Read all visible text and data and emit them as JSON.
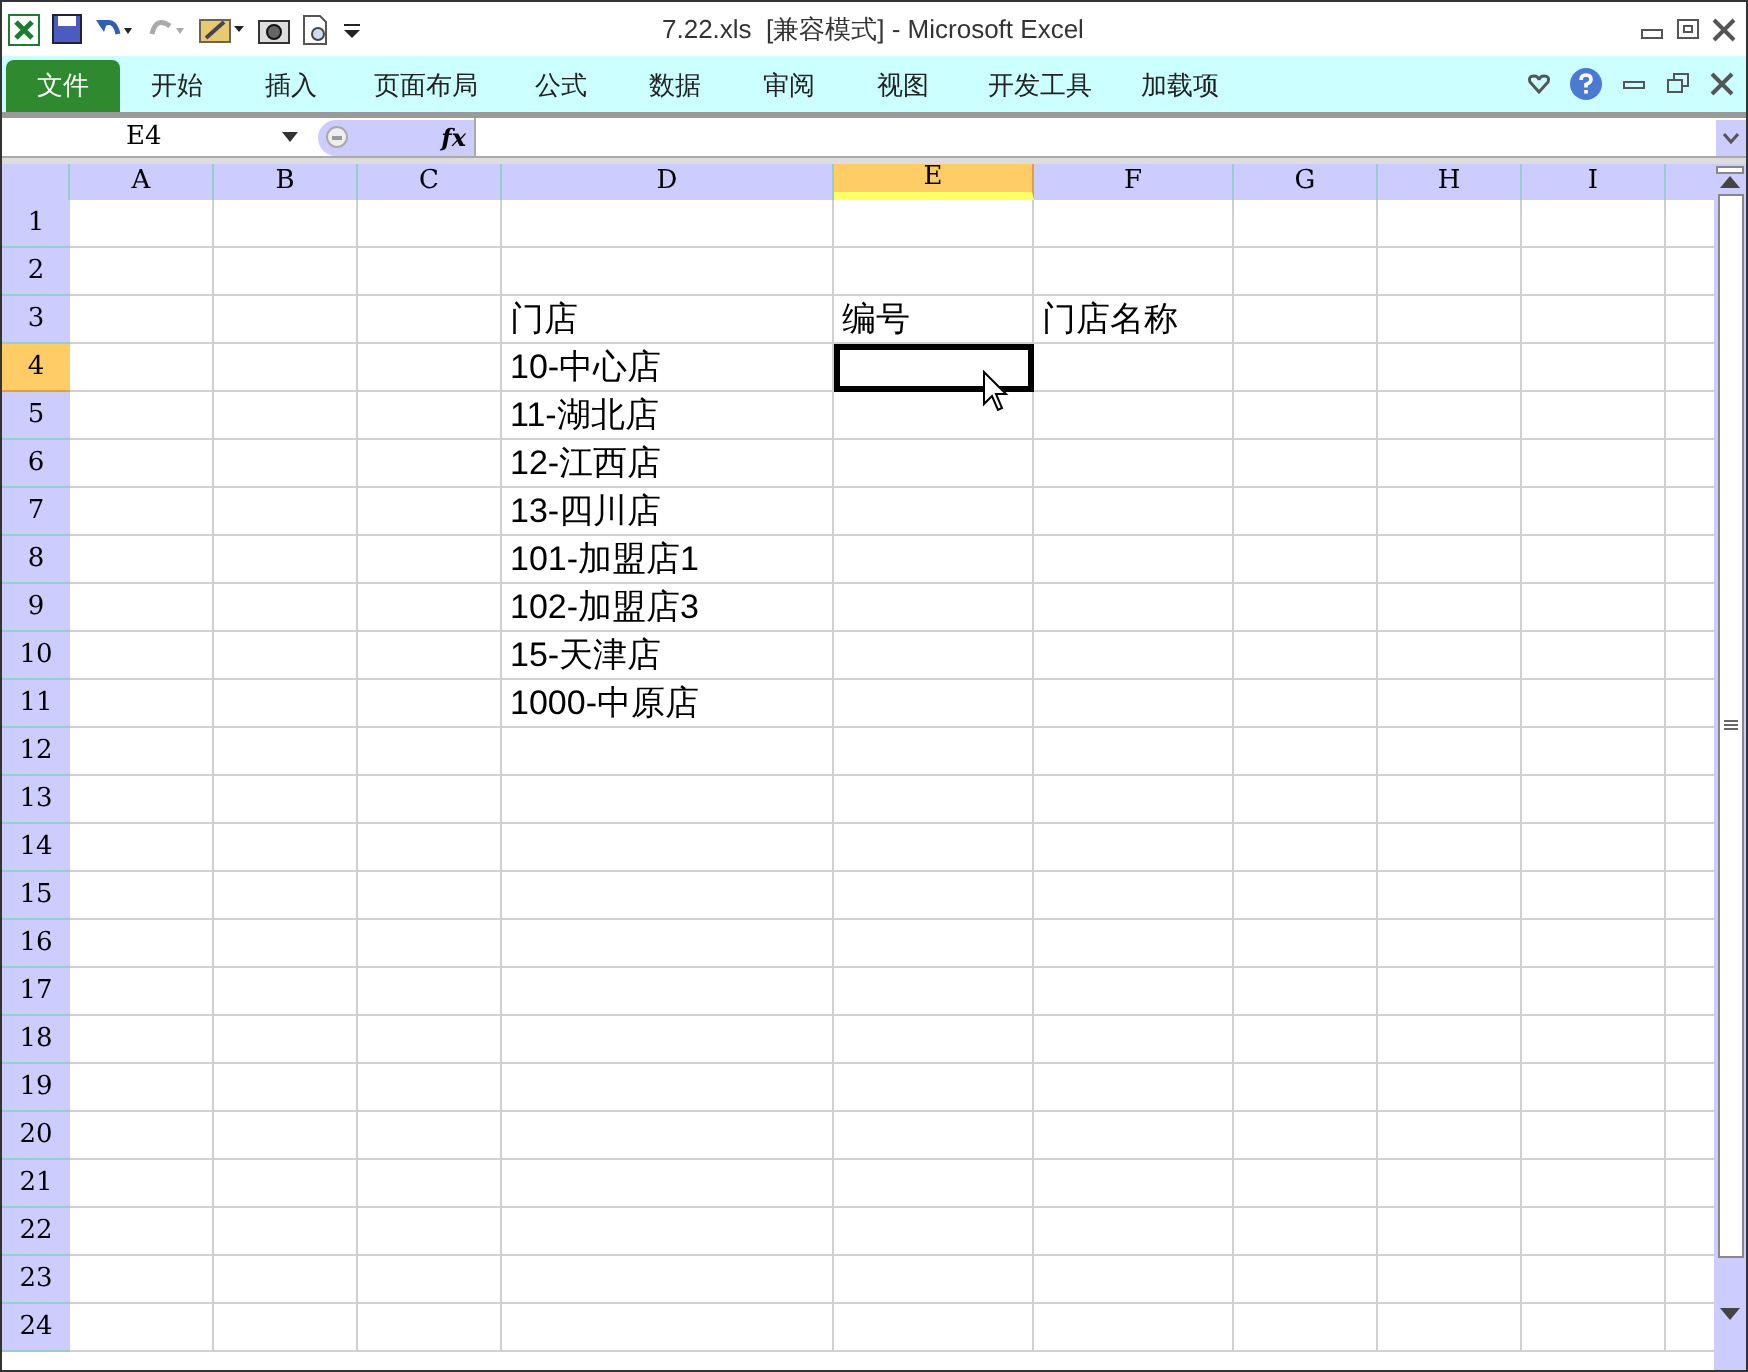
{
  "window": {
    "title": "7.22.xls  [兼容模式] - Microsoft Excel"
  },
  "ribbon_tabs": [
    {
      "label": "文件",
      "selected": true
    },
    {
      "label": "开始",
      "selected": false
    },
    {
      "label": "插入",
      "selected": false
    },
    {
      "label": "页面布局",
      "selected": false
    },
    {
      "label": "公式",
      "selected": false
    },
    {
      "label": "数据",
      "selected": false
    },
    {
      "label": "审阅",
      "selected": false
    },
    {
      "label": "视图",
      "selected": false
    },
    {
      "label": "开发工具",
      "selected": false
    },
    {
      "label": "加载项",
      "selected": false
    }
  ],
  "formula_bar": {
    "name_box": "E4",
    "fx": "fx"
  },
  "columns": [
    {
      "label": "A",
      "selected": false
    },
    {
      "label": "B",
      "selected": false
    },
    {
      "label": "C",
      "selected": false
    },
    {
      "label": "D",
      "selected": false
    },
    {
      "label": "E",
      "selected": true
    },
    {
      "label": "F",
      "selected": false
    },
    {
      "label": "G",
      "selected": false
    },
    {
      "label": "H",
      "selected": false
    },
    {
      "label": "I",
      "selected": false
    }
  ],
  "rows": [
    {
      "label": "1",
      "selected": false
    },
    {
      "label": "2",
      "selected": false
    },
    {
      "label": "3",
      "selected": false,
      "D": "门店",
      "E": "编号",
      "F": "门店名称"
    },
    {
      "label": "4",
      "selected": true,
      "D": "10-中心店"
    },
    {
      "label": "5",
      "selected": false,
      "D": "11-湖北店"
    },
    {
      "label": "6",
      "selected": false,
      "D": "12-江西店"
    },
    {
      "label": "7",
      "selected": false,
      "D": "13-四川店"
    },
    {
      "label": "8",
      "selected": false,
      "D": "101-加盟店1"
    },
    {
      "label": "9",
      "selected": false,
      "D": "102-加盟店3"
    },
    {
      "label": "10",
      "selected": false,
      "D": "15-天津店"
    },
    {
      "label": "11",
      "selected": false,
      "D": "1000-中原店"
    },
    {
      "label": "12",
      "selected": false
    },
    {
      "label": "13",
      "selected": false
    },
    {
      "label": "14",
      "selected": false
    },
    {
      "label": "15",
      "selected": false
    },
    {
      "label": "16",
      "selected": false
    },
    {
      "label": "17",
      "selected": false
    },
    {
      "label": "18",
      "selected": false
    },
    {
      "label": "19",
      "selected": false
    },
    {
      "label": "20",
      "selected": false
    },
    {
      "label": "21",
      "selected": false
    },
    {
      "label": "22",
      "selected": false
    },
    {
      "label": "23",
      "selected": false
    },
    {
      "label": "24",
      "selected": false
    }
  ]
}
